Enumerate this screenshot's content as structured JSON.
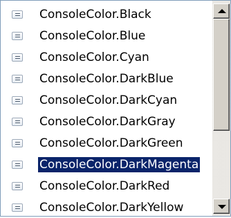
{
  "listbox": {
    "items": [
      {
        "label": "ConsoleColor.Black",
        "icon": "enum-member-icon"
      },
      {
        "label": "ConsoleColor.Blue",
        "icon": "enum-member-icon"
      },
      {
        "label": "ConsoleColor.Cyan",
        "icon": "enum-member-icon"
      },
      {
        "label": "ConsoleColor.DarkBlue",
        "icon": "enum-member-icon"
      },
      {
        "label": "ConsoleColor.DarkCyan",
        "icon": "enum-member-icon"
      },
      {
        "label": "ConsoleColor.DarkGray",
        "icon": "enum-member-icon"
      },
      {
        "label": "ConsoleColor.DarkGreen",
        "icon": "enum-member-icon"
      },
      {
        "label": "ConsoleColor.DarkMagenta",
        "icon": "enum-member-icon"
      },
      {
        "label": "ConsoleColor.DarkRed",
        "icon": "enum-member-icon"
      },
      {
        "label": "ConsoleColor.DarkYellow",
        "icon": "enum-member-icon"
      }
    ],
    "selected_label": "ConsoleColor.DarkMagenta",
    "selection_color": "#0a246a"
  },
  "scrollbar": {
    "up_icon": "triangle-up-icon",
    "down_icon": "triangle-down-icon"
  }
}
